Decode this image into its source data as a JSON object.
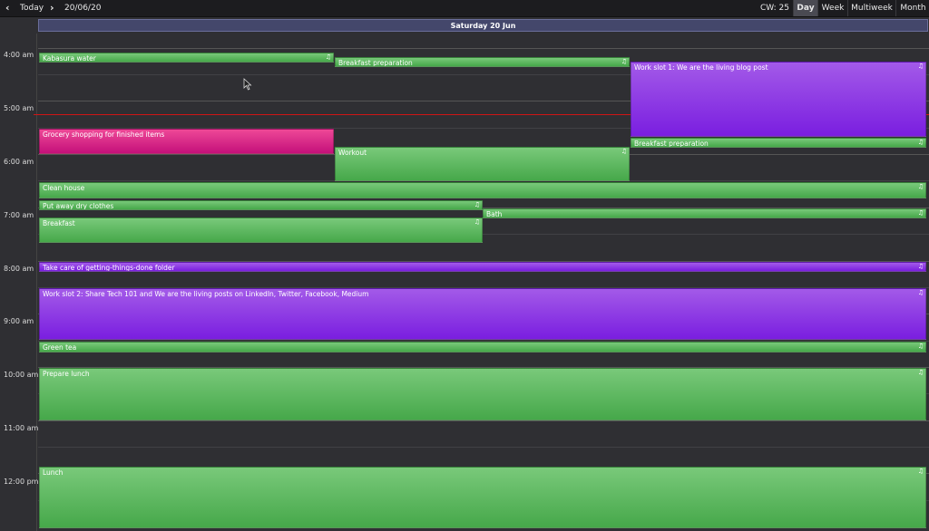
{
  "toolbar": {
    "prev_icon": "chevron-left-icon",
    "today_label": "Today",
    "next_icon": "chevron-right-icon",
    "date": "20/06/20",
    "cw": "CW: 25",
    "views": [
      "Day",
      "Week",
      "Multiweek",
      "Month"
    ],
    "active_view": "Day"
  },
  "day_header": "Saturday 20 Jun",
  "hours": [
    "4:00 am",
    "5:00 am",
    "6:00 am",
    "7:00 am",
    "8:00 am",
    "9:00 am",
    "10:00 am",
    "11:00 am",
    "12:00 pm"
  ],
  "events": [
    {
      "title": "Kabasura water",
      "color": "green",
      "bell": true
    },
    {
      "title": "Breakfast preparation",
      "color": "green",
      "bell": true
    },
    {
      "title": "Work slot 1: We are the living blog post",
      "color": "purple",
      "bell": true
    },
    {
      "title": "Breakfast preparation",
      "color": "green",
      "bell": true
    },
    {
      "title": "Grocery shopping for finished items",
      "color": "pink",
      "bell": false
    },
    {
      "title": "Workout",
      "color": "green",
      "bell": true
    },
    {
      "title": "Clean house",
      "color": "green",
      "bell": true
    },
    {
      "title": "Put away dry clothes",
      "color": "green",
      "bell": true
    },
    {
      "title": "Bath",
      "color": "green",
      "bell": true
    },
    {
      "title": "Breakfast",
      "color": "green",
      "bell": true
    },
    {
      "title": "Take care of getting-things-done folder",
      "color": "purple",
      "bell": true
    },
    {
      "title": "Work slot 2: Share Tech 101 and We are the living posts on LinkedIn, Twitter, Facebook, Medium",
      "color": "purple",
      "bell": true
    },
    {
      "title": "Green tea",
      "color": "green",
      "bell": true
    },
    {
      "title": "Prepare lunch",
      "color": "green",
      "bell": true
    },
    {
      "title": "Lunch",
      "color": "green",
      "bell": true
    }
  ],
  "colors": {
    "green": "#4caf50",
    "purple": "#8a2be2",
    "pink": "#d81b7a",
    "now_line": "#d01515"
  }
}
